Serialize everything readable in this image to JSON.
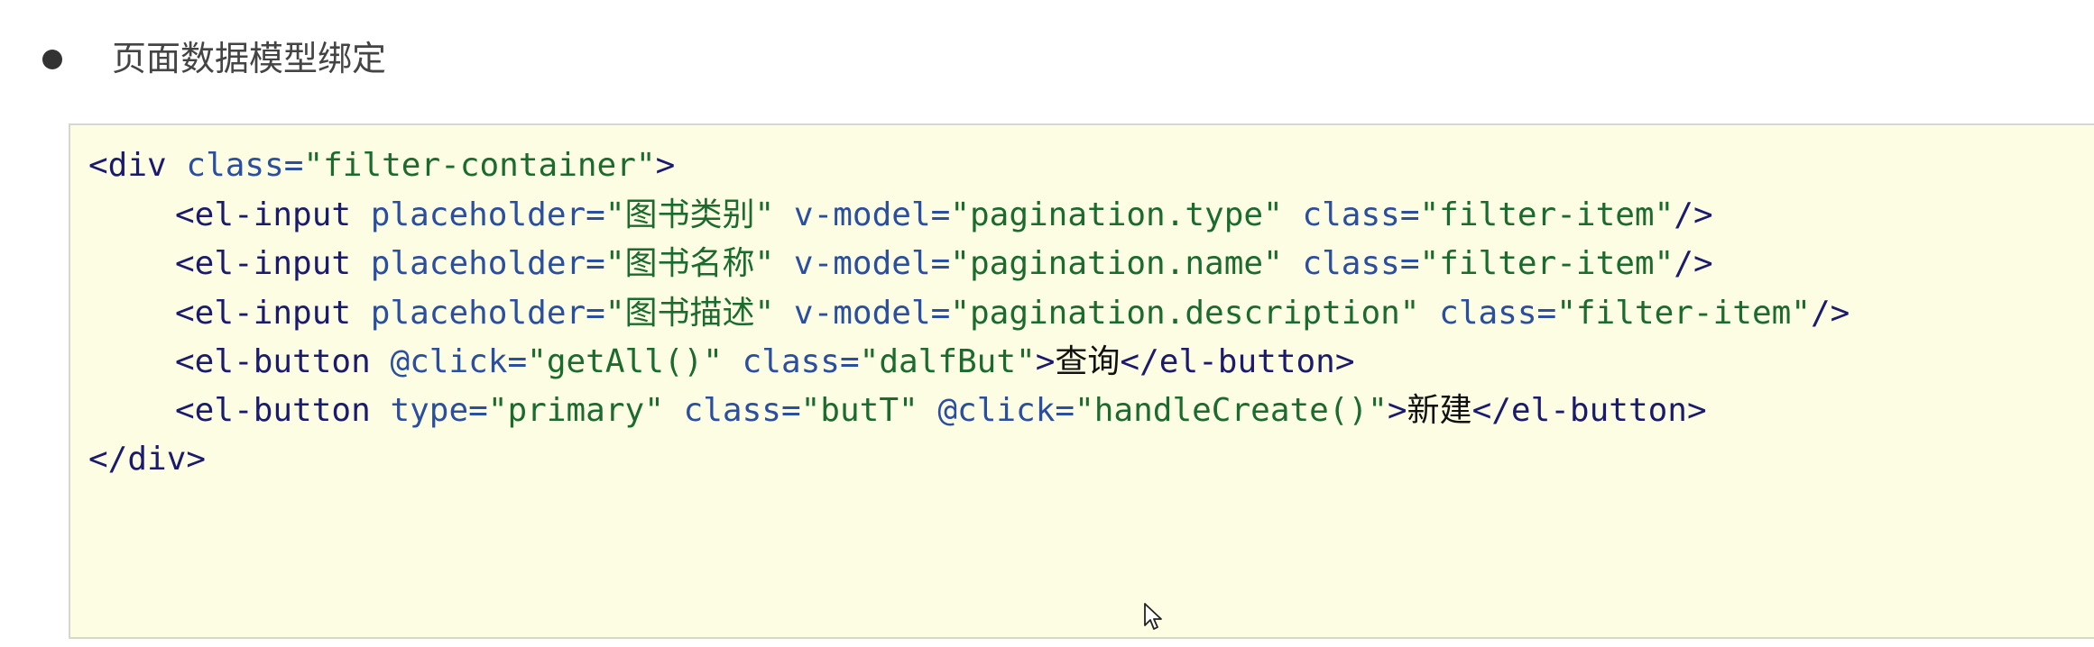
{
  "heading": {
    "text": "页面数据模型绑定",
    "bullet_icon": "bullet-dot-icon"
  },
  "code": {
    "lines": [
      {
        "indent": false,
        "tokens": [
          {
            "t": "tag",
            "v": "<div"
          },
          {
            "t": "plain",
            "v": " "
          },
          {
            "t": "attr",
            "v": "class="
          },
          {
            "t": "val",
            "v": "\"filter-container\""
          },
          {
            "t": "tag",
            "v": ">"
          }
        ]
      },
      {
        "indent": true,
        "tokens": [
          {
            "t": "tag",
            "v": "<el-input"
          },
          {
            "t": "plain",
            "v": " "
          },
          {
            "t": "attr",
            "v": "placeholder="
          },
          {
            "t": "val",
            "v": "\"图书类别\""
          },
          {
            "t": "plain",
            "v": " "
          },
          {
            "t": "attr",
            "v": "v-model="
          },
          {
            "t": "val",
            "v": "\"pagination.type\""
          },
          {
            "t": "plain",
            "v": " "
          },
          {
            "t": "attr",
            "v": "class="
          },
          {
            "t": "val",
            "v": "\"filter-item\""
          },
          {
            "t": "tag",
            "v": "/>"
          }
        ]
      },
      {
        "indent": true,
        "tokens": [
          {
            "t": "tag",
            "v": "<el-input"
          },
          {
            "t": "plain",
            "v": " "
          },
          {
            "t": "attr",
            "v": "placeholder="
          },
          {
            "t": "val",
            "v": "\"图书名称\""
          },
          {
            "t": "plain",
            "v": " "
          },
          {
            "t": "attr",
            "v": "v-model="
          },
          {
            "t": "val",
            "v": "\"pagination.name\""
          },
          {
            "t": "plain",
            "v": " "
          },
          {
            "t": "attr",
            "v": "class="
          },
          {
            "t": "val",
            "v": "\"filter-item\""
          },
          {
            "t": "tag",
            "v": "/>"
          }
        ]
      },
      {
        "indent": true,
        "tokens": [
          {
            "t": "tag",
            "v": "<el-input"
          },
          {
            "t": "plain",
            "v": " "
          },
          {
            "t": "attr",
            "v": "placeholder="
          },
          {
            "t": "val",
            "v": "\"图书描述\""
          },
          {
            "t": "plain",
            "v": " "
          },
          {
            "t": "attr",
            "v": "v-model="
          },
          {
            "t": "val",
            "v": "\"pagination.description\""
          },
          {
            "t": "plain",
            "v": " "
          },
          {
            "t": "attr",
            "v": "class="
          },
          {
            "t": "val",
            "v": "\"filter-item\""
          },
          {
            "t": "tag",
            "v": "/>"
          }
        ]
      },
      {
        "indent": true,
        "tokens": [
          {
            "t": "tag",
            "v": "<el-button"
          },
          {
            "t": "plain",
            "v": " "
          },
          {
            "t": "attr",
            "v": "@click="
          },
          {
            "t": "val",
            "v": "\"getAll()\""
          },
          {
            "t": "plain",
            "v": " "
          },
          {
            "t": "attr",
            "v": "class="
          },
          {
            "t": "val",
            "v": "\"dalfBut\""
          },
          {
            "t": "tag",
            "v": ">"
          },
          {
            "t": "text",
            "v": "查询"
          },
          {
            "t": "tag",
            "v": "</el-button>"
          }
        ]
      },
      {
        "indent": true,
        "tokens": [
          {
            "t": "tag",
            "v": "<el-button"
          },
          {
            "t": "plain",
            "v": " "
          },
          {
            "t": "attr",
            "v": "type="
          },
          {
            "t": "val",
            "v": "\"primary\""
          },
          {
            "t": "plain",
            "v": " "
          },
          {
            "t": "attr",
            "v": "class="
          },
          {
            "t": "val",
            "v": "\"butT\""
          },
          {
            "t": "plain",
            "v": " "
          },
          {
            "t": "attr",
            "v": "@click="
          },
          {
            "t": "val",
            "v": "\"handleCreate()\""
          },
          {
            "t": "tag",
            "v": ">"
          },
          {
            "t": "text",
            "v": "新建"
          },
          {
            "t": "tag",
            "v": "</el-button>"
          }
        ]
      },
      {
        "indent": false,
        "tokens": [
          {
            "t": "tag",
            "v": "</div>"
          }
        ]
      }
    ]
  },
  "colors": {
    "code_background": "#fdfde4",
    "code_border": "#d7d7d0",
    "tag": "#1a1a6e",
    "attr": "#2a4ea0",
    "value": "#1b6a2e"
  },
  "cursor_icon": "mouse-pointer-icon"
}
